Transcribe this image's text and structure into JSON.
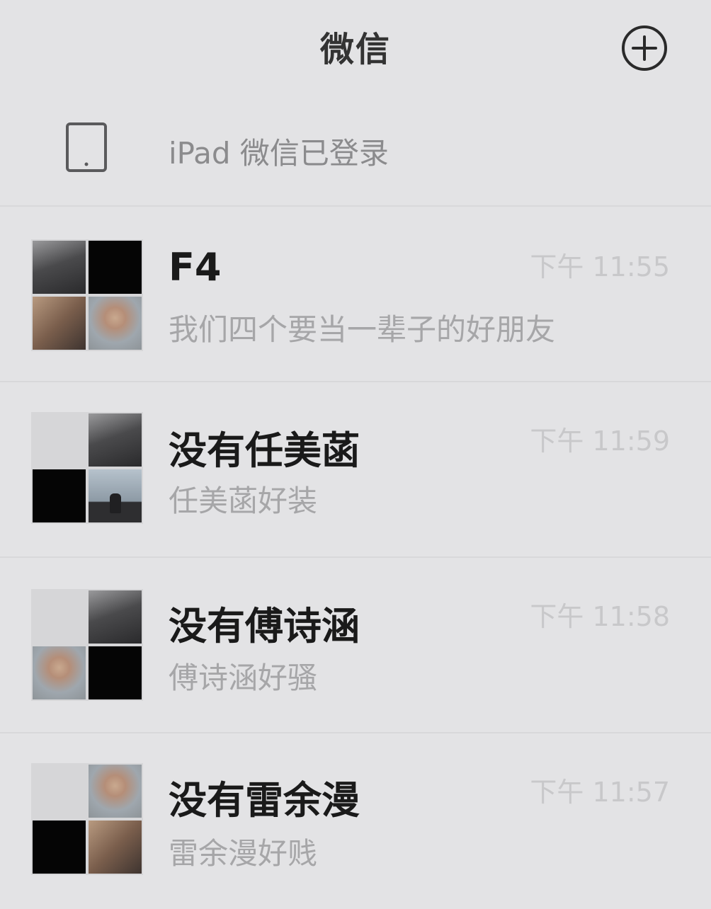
{
  "header": {
    "title": "微信",
    "add_icon": "plus-circle-icon"
  },
  "login_notice": {
    "icon": "tablet-icon",
    "text": "iPad 微信已登录"
  },
  "chats": [
    {
      "name": "F4",
      "time": "下午 11:55",
      "preview": "我们四个要当一辈子的好朋友",
      "avatar": [
        "man",
        "black",
        "group",
        "girl"
      ]
    },
    {
      "name": "没有任美菡",
      "time": "下午 11:59",
      "preview": "任美菡好装",
      "avatar": [
        "blank",
        "man",
        "black",
        "sky"
      ]
    },
    {
      "name": "没有傅诗涵",
      "time": "下午 11:58",
      "preview": "傅诗涵好骚",
      "avatar": [
        "blank",
        "man",
        "girl",
        "black"
      ]
    },
    {
      "name": "没有雷余漫",
      "time": "下午 11:57",
      "preview": "雷余漫好贱",
      "avatar": [
        "blank",
        "girl",
        "black",
        "group"
      ]
    }
  ],
  "colors": {
    "background": "#e3e3e5",
    "title": "#333333",
    "name": "#1a1a1a",
    "preview": "#a6a6a8",
    "time": "#c8c8ca"
  }
}
